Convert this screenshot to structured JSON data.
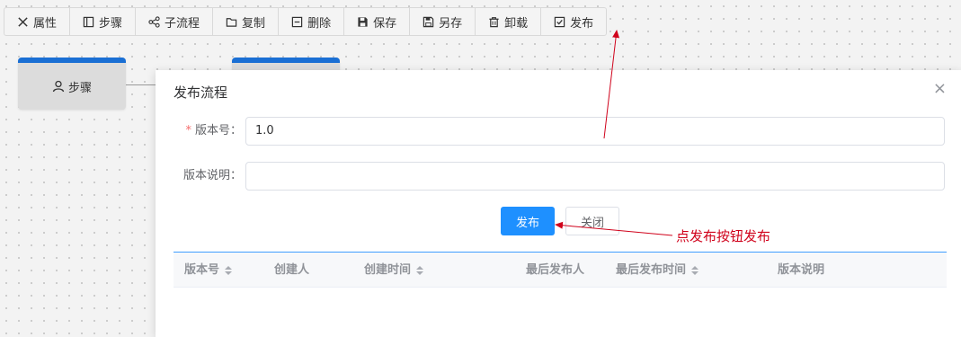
{
  "toolbar": {
    "items": [
      {
        "label": "属性",
        "icon": "tools-icon"
      },
      {
        "label": "步骤",
        "icon": "panel-icon"
      },
      {
        "label": "子流程",
        "icon": "share-icon"
      },
      {
        "label": "复制",
        "icon": "folder-icon"
      },
      {
        "label": "删除",
        "icon": "minus-square-icon"
      },
      {
        "label": "保存",
        "icon": "save-icon"
      },
      {
        "label": "另存",
        "icon": "save-as-icon"
      },
      {
        "label": "卸载",
        "icon": "trash-icon"
      },
      {
        "label": "发布",
        "icon": "check-square-icon"
      }
    ]
  },
  "canvas": {
    "node1_label": "步骤",
    "accent_color": "#1a6fd4"
  },
  "dialog": {
    "title": "发布流程",
    "close_glyph": "×",
    "version_label": "版本号：",
    "required_mark": "*",
    "version_value": "1.0",
    "desc_label": "版本说明：",
    "desc_value": "",
    "publish_button": "发布",
    "close_button": "关闭",
    "primary_color": "#1e90ff",
    "table": {
      "columns": [
        {
          "label": "版本号",
          "sortable": true
        },
        {
          "label": "创建人",
          "sortable": false
        },
        {
          "label": "创建时间",
          "sortable": true
        },
        {
          "label": "最后发布人",
          "sortable": false
        },
        {
          "label": "最后发布时间",
          "sortable": true
        },
        {
          "label": "版本说明",
          "sortable": false
        }
      ]
    }
  },
  "annotation": {
    "text": "点发布按钮发布",
    "color": "#d0021b"
  }
}
